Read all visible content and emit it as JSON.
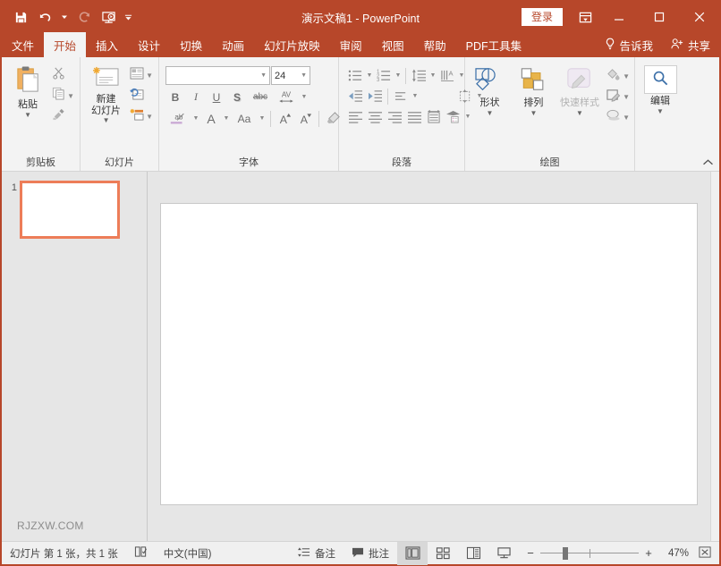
{
  "titlebar": {
    "document_title": "演示文稿1  -  PowerPoint",
    "qat": [
      {
        "name": "save-icon",
        "label": "保存"
      },
      {
        "name": "undo-icon",
        "label": "撤消"
      },
      {
        "name": "redo-icon",
        "label": "恢复"
      },
      {
        "name": "start-slideshow-icon",
        "label": "从头开始"
      },
      {
        "name": "customize-qat-icon",
        "label": "自定义快速访问工具栏"
      }
    ],
    "signin_label": "登录",
    "ribbon_display_icon": "ribbon-display-options-icon",
    "minimize_icon": "minimize-icon",
    "maximize_icon": "maximize-icon",
    "close_icon": "close-icon",
    "bg_color": "#b7472a",
    "signin_text_color": "#b7472a"
  },
  "tabs": [
    {
      "id": "file",
      "label": "文件",
      "active": false
    },
    {
      "id": "home",
      "label": "开始",
      "active": true
    },
    {
      "id": "insert",
      "label": "插入",
      "active": false
    },
    {
      "id": "design",
      "label": "设计",
      "active": false
    },
    {
      "id": "transitions",
      "label": "切换",
      "active": false
    },
    {
      "id": "animations",
      "label": "动画",
      "active": false
    },
    {
      "id": "slideshow",
      "label": "幻灯片放映",
      "active": false
    },
    {
      "id": "review",
      "label": "审阅",
      "active": false
    },
    {
      "id": "view",
      "label": "视图",
      "active": false
    },
    {
      "id": "help",
      "label": "帮助",
      "active": false
    },
    {
      "id": "pdftools",
      "label": "PDF工具集",
      "active": false
    }
  ],
  "tabbar_right": {
    "tell_me_label": "告诉我",
    "tell_me_icon": "lightbulb-icon",
    "share_label": "共享",
    "share_icon": "share-person-icon"
  },
  "ribbon": {
    "groups": [
      {
        "id": "clipboard",
        "title": "剪贴板",
        "has_dialog_launcher": true,
        "big_button": {
          "label": "粘贴",
          "icon": "paste-icon",
          "has_caret": true
        },
        "small_buttons": [
          {
            "label": "剪切",
            "icon": "cut-scissors-icon",
            "has_caret": false
          },
          {
            "label": "复制",
            "icon": "copy-icon",
            "has_caret": true
          },
          {
            "label": "格式刷",
            "icon": "format-painter-icon",
            "has_caret": false
          }
        ]
      },
      {
        "id": "slides",
        "title": "幻灯片",
        "has_dialog_launcher": false,
        "big_button": {
          "label": "新建\n幻灯片",
          "line1": "新建",
          "line2": "幻灯片",
          "icon": "new-slide-icon",
          "has_caret": true
        },
        "small_buttons": [
          {
            "label": "版式",
            "icon": "layout-icon",
            "has_caret": true
          },
          {
            "label": "重设",
            "icon": "reset-slide-icon",
            "has_caret": false
          },
          {
            "label": "节",
            "icon": "section-icon",
            "has_caret": true
          }
        ]
      },
      {
        "id": "font",
        "title": "字体",
        "has_dialog_launcher": true,
        "font_name": {
          "value": "",
          "placeholder": ""
        },
        "font_size": {
          "value": "24"
        },
        "row2": [
          {
            "label": "B",
            "name": "bold-button"
          },
          {
            "label": "I",
            "name": "italic-button"
          },
          {
            "label": "U",
            "name": "underline-button"
          },
          {
            "label": "S",
            "name": "shadow-button"
          },
          {
            "label": "abc",
            "name": "strikethrough-button"
          },
          {
            "label": "AV",
            "name": "character-spacing-button",
            "has_caret": true
          }
        ],
        "row3": [
          {
            "label": "ab",
            "name": "clear-formatting-button",
            "has_caret": true
          },
          {
            "label": "A",
            "name": "font-color-button",
            "has_caret": true
          },
          {
            "label": "Aa",
            "name": "change-case-button",
            "has_caret": true
          },
          {
            "label": "A",
            "name": "increase-font-size-button"
          },
          {
            "label": "A",
            "name": "decrease-font-size-button"
          },
          {
            "label": "",
            "name": "text-highlight-color-button"
          }
        ]
      },
      {
        "id": "paragraph",
        "title": "段落",
        "has_dialog_launcher": true,
        "row1": [
          "bullets-icon",
          "numbering-icon",
          "line-spacing-icon",
          "text-direction-icon"
        ],
        "row2": [
          "decrease-indent-icon",
          "increase-indent-icon",
          "align-text-icon",
          "convert-to-smartart-icon"
        ],
        "row3": [
          "align-left-icon",
          "align-center-icon",
          "align-right-icon",
          "justify-icon",
          "columns-icon",
          "text-direction-vertical-icon"
        ]
      },
      {
        "id": "drawing",
        "title": "绘图",
        "has_dialog_launcher": true,
        "big_buttons": [
          {
            "label": "形状",
            "icon": "shapes-icon",
            "has_caret": true,
            "disabled": false
          },
          {
            "label": "排列",
            "icon": "arrange-icon",
            "has_caret": true,
            "disabled": false
          },
          {
            "label": "快速样式",
            "icon": "quick-styles-icon",
            "has_caret": true,
            "disabled": true
          }
        ],
        "small_buttons": [
          {
            "label": "形状填充",
            "icon": "shape-fill-icon",
            "has_caret": true
          },
          {
            "label": "形状轮廓",
            "icon": "shape-outline-icon",
            "has_caret": true
          },
          {
            "label": "形状效果",
            "icon": "shape-effects-icon",
            "has_caret": true
          }
        ]
      },
      {
        "id": "editing",
        "title": "",
        "has_dialog_launcher": false,
        "big_button": {
          "label": "编辑",
          "icon": "search-magnifier-icon",
          "has_caret": true
        }
      }
    ],
    "collapse_icon": "collapse-ribbon-chevron-up-icon"
  },
  "thumbnails": {
    "slides": [
      {
        "number": "1",
        "selected": true
      }
    ],
    "watermark": "RJZXW.COM"
  },
  "statusbar": {
    "slide_count_text": "幻灯片 第 1 张，共 1 张",
    "accessibility_icon": "accessibility-checker-icon",
    "language": "中文(中国)",
    "notes_label": "备注",
    "notes_icon": "notes-icon",
    "comments_label": "批注",
    "comments_icon": "comment-bubble-icon",
    "views": [
      {
        "name": "normal-view-button",
        "active": true
      },
      {
        "name": "slide-sorter-view-button",
        "active": false
      },
      {
        "name": "reading-view-button",
        "active": false
      },
      {
        "name": "slideshow-view-button",
        "active": false
      }
    ],
    "zoom_out_label": "−",
    "zoom_in_label": "+",
    "zoom_percent": "47%",
    "fit_slide_icon": "fit-slide-to-window-icon"
  },
  "colors": {
    "accent": "#b7472a",
    "thumb_selected_border": "#ed7d58",
    "ribbon_bg": "#f3f3f3",
    "canvas_bg": "#e6e6e6"
  }
}
